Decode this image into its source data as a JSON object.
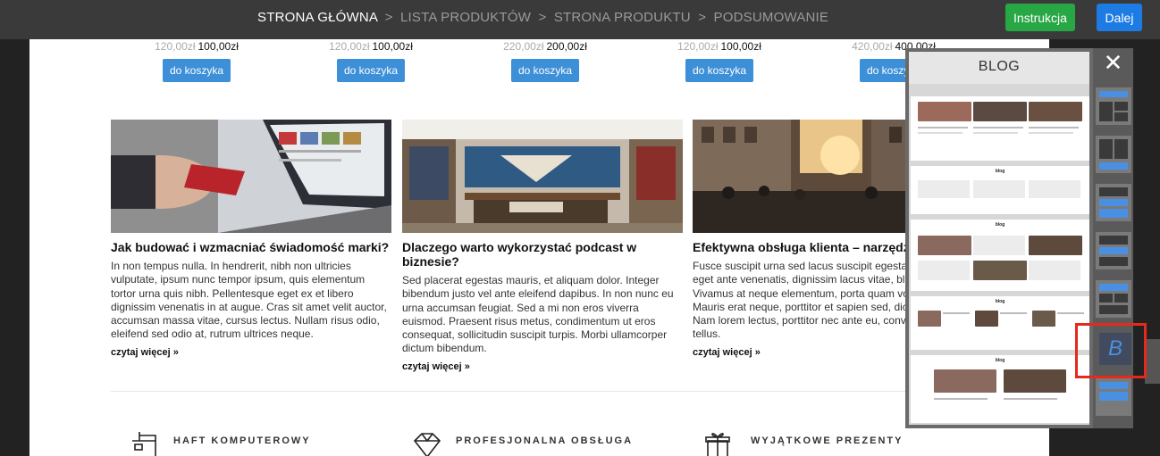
{
  "topbar": {
    "crumbs": [
      "STRONA GŁÓWNA",
      "LISTA PRODUKTÓW",
      "STRONA PRODUKTU",
      "PODSUMOWANIE"
    ],
    "separator": ">",
    "instruction_label": "Instrukcja",
    "next_label": "Dalej"
  },
  "products": [
    {
      "old_price": "120,00zł",
      "price": "100,00zł",
      "button": "do koszyka"
    },
    {
      "old_price": "120,00zł",
      "price": "100,00zł",
      "button": "do koszyka"
    },
    {
      "old_price": "220,00zł",
      "price": "200,00zł",
      "button": "do koszyka"
    },
    {
      "old_price": "120,00zł",
      "price": "100,00zł",
      "button": "do koszyka"
    },
    {
      "old_price": "420,00zł",
      "price": "400,00zł",
      "button": "do koszyka"
    }
  ],
  "posts": [
    {
      "title": "Jak budować i wzmacniać świadomość marki?",
      "text": "In non tempus nulla. In hendrerit, nibh non ultricies vulputate, ipsum nunc tempor ipsum, quis elementum tortor urna quis nibh. Pellentesque eget ex et libero dignissim venenatis in at augue. Cras sit amet velit auctor, accumsan massa vitae, cursus lectus. Nullam risus odio, eleifend sed odio at, rutrum ultrices neque.",
      "more": "czytaj więcej »"
    },
    {
      "title": "Dlaczego warto wykorzystać podcast w biznesie?",
      "text": "Sed placerat egestas mauris, et aliquam dolor. Integer bibendum justo vel ante eleifend dapibus. In non nunc eu urna accumsan feugiat. Sed a mi non eros viverra euismod. Praesent risus metus, condimentum ut eros consequat, sollicitudin suscipit turpis. Morbi ullamcorper dictum bibendum.",
      "more": "czytaj więcej »"
    },
    {
      "title": "Efektywna obsługa klienta – narzędzia",
      "text": "Fusce suscipit urna sed lacus suscipit egestas. Nullam eget ante venenatis, dignissim lacus vitae, blandit magna. Vivamus at neque elementum, porta quam volutpat lacus. Mauris erat neque, porttitor et sapien sed, dictum id dui. Nam lorem lectus, porttitor nec ante eu, convallis mollis tellus.",
      "more": "czytaj więcej »"
    }
  ],
  "features": [
    "HAFT KOMPUTEROWY",
    "PROFESJONALNA OBSŁUGA",
    "WYJĄTKOWE PREZENTY"
  ],
  "blog_panel": {
    "title": "BLOG",
    "thumb_title": "blog",
    "close_glyph": "✕",
    "selected_tile_letter": "B"
  },
  "colors": {
    "topbar": "#3a3a3a",
    "instruction": "#28a745",
    "next": "#1d7ce3",
    "cart_button": "#3d8fd8",
    "selection_frame": "#e52a1c"
  }
}
